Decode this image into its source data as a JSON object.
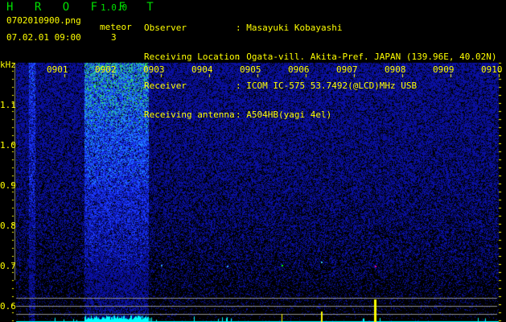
{
  "header": {
    "app_name": "H R O F F T",
    "version": "1.0.0",
    "filename": "0702010900.png",
    "datetime": "07.02.01 09:00",
    "meteor_label": "meteor",
    "meteor_count": "3",
    "info": [
      {
        "label": "Observer",
        "value": ": Masayuki Kobayashi"
      },
      {
        "label": "Receiving Location",
        "value": ": Ogata-vill. Akita-Pref. JAPAN (139.96E, 40.02N)"
      },
      {
        "label": "Receiver",
        "value": ": ICOM IC-575 53.7492(@LCD)MHz USB"
      },
      {
        "label": "Receiving antenna",
        "value": ": A504HB(yagi 4el)"
      }
    ]
  },
  "spectrogram": {
    "y_unit": "kHz",
    "y_ticks": [
      "1.1",
      "1.0",
      "0.9",
      "0.8",
      "0.7",
      "0.6"
    ],
    "time_labels": [
      "0901",
      "0902",
      "0903",
      "0904",
      "0905",
      "0906",
      "0907",
      "0908",
      "0909",
      "0910"
    ],
    "colors": {
      "text": "#ffff00",
      "logo": "#00e000",
      "bars": "#00ffff",
      "peaks": "#ffff00"
    }
  }
}
